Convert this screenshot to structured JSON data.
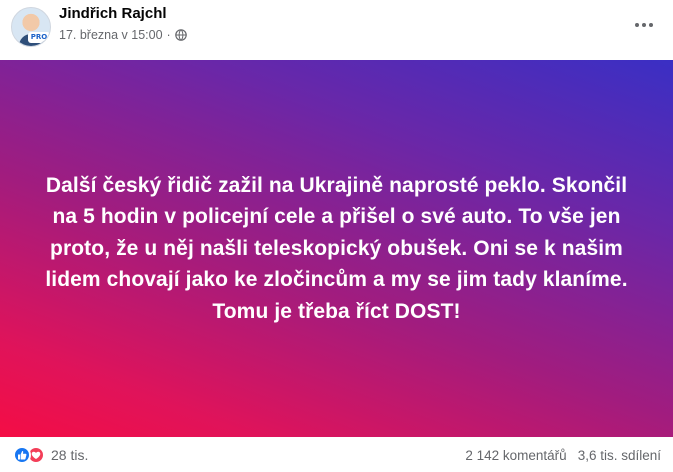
{
  "post": {
    "author": "Jindřich Rajchl",
    "avatar_badge": "PRO",
    "timestamp": "17. března v 15:00",
    "separator": "·",
    "privacy_icon": "globe-icon",
    "more_icon": "more-options-icon",
    "image_text": "Další český řidič zažil na Ukrajině naprosté peklo. Skončil na 5 hodin v policejní cele a přišel o své auto. To vše jen proto, že u něj našli teleskopický obušek. Oni se k našim lidem chovají jako ke zločincům a my se jim tady klaníme. Tomu je třeba říct DOST!"
  },
  "footer": {
    "reaction_icons": [
      "like-icon",
      "love-icon"
    ],
    "reaction_count": "28 tis.",
    "comments": "2 142 komentářů",
    "shares": "3,6 tis. sdílení"
  },
  "colors": {
    "gradient_top_right": "#3a2fc4",
    "gradient_bottom_left": "#f40d45",
    "like": "#1877f2",
    "love": "#f33e58",
    "secondary_text": "#65676b"
  }
}
